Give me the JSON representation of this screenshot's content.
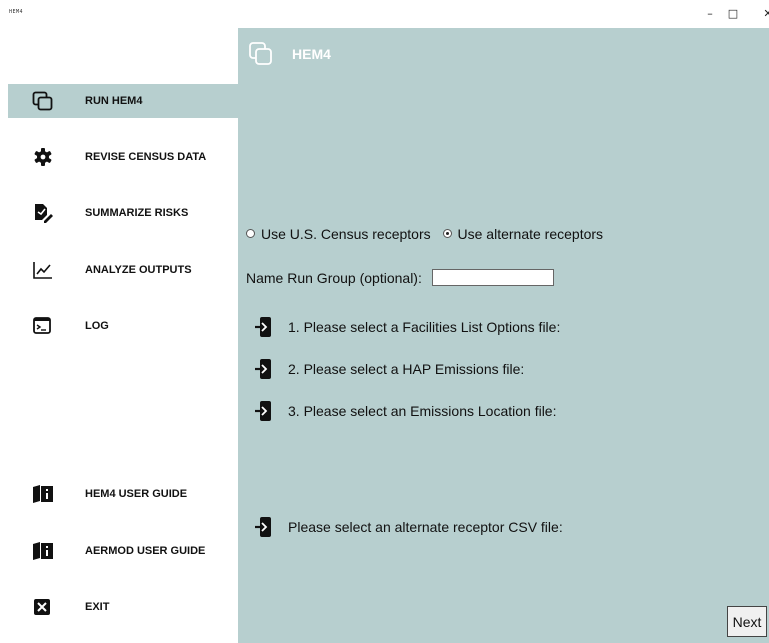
{
  "window": {
    "app_name": "HEM4",
    "minimize_glyph": "–",
    "maximize_glyph": "□",
    "close_glyph": "✕"
  },
  "sidebar": {
    "items": [
      {
        "label": "RUN HEM4",
        "icon": "copy-icon",
        "active": true
      },
      {
        "label": "REVISE CENSUS DATA",
        "icon": "gear-icon",
        "active": false
      },
      {
        "label": "SUMMARIZE RISKS",
        "icon": "edit-document-icon",
        "active": false
      },
      {
        "label": "ANALYZE OUTPUTS",
        "icon": "line-chart-icon",
        "active": false
      },
      {
        "label": "LOG",
        "icon": "terminal-icon",
        "active": false
      },
      {
        "label": "HEM4 USER GUIDE",
        "icon": "book-info-icon",
        "active": false
      },
      {
        "label": "AERMOD USER GUIDE",
        "icon": "book-info-icon",
        "active": false
      },
      {
        "label": "EXIT",
        "icon": "exit-x-icon",
        "active": false
      }
    ]
  },
  "main": {
    "title": "HEM4",
    "receptor_options": [
      {
        "label": "Use U.S. Census receptors",
        "checked": false
      },
      {
        "label": "Use alternate receptors",
        "checked": true
      }
    ],
    "run_group": {
      "label": "Name Run Group (optional):",
      "value": ""
    },
    "file_prompts": [
      "1. Please select a Facilities List Options file:",
      "2. Please select a HAP Emissions file:",
      "3. Please select an Emissions Location file:",
      "Please select an alternate receptor CSV file:"
    ],
    "next_label": "Next"
  },
  "colors": {
    "accent": "#b7cfcf",
    "sidebar_bg": "#ffffff",
    "header_text": "#ffffff"
  }
}
